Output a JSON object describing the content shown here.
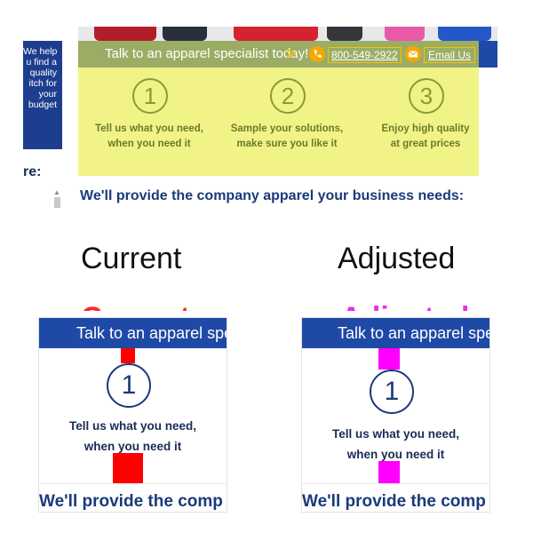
{
  "left_panel": {
    "lines": [
      "We help",
      "u find a",
      "quality",
      "itch for",
      "your",
      "budget"
    ]
  },
  "side_heading": "re:",
  "cta_bar": {
    "text": "Talk to an apparel specialist today!",
    "chevron": ">",
    "phone": "800-549-2922",
    "email": "Email Us",
    "phone_icon": "phone-icon",
    "mail_icon": "mail-icon"
  },
  "steps": [
    {
      "number": "1",
      "line1": "Tell us what you need,",
      "line2": "when you need it"
    },
    {
      "number": "2",
      "line1": "Sample your solutions,",
      "line2": "make sure you like it"
    },
    {
      "number": "3",
      "line1": "Enjoy high quality",
      "line2": "at great prices"
    }
  ],
  "provide_text": "We'll provide the company apparel your business needs:",
  "labels": {
    "current": "Current",
    "adjusted": "Adjusted"
  },
  "panels": {
    "bar_text": "Talk to an apparel speci",
    "number": "1",
    "line1": "Tell us what you need,",
    "line2": "when you need it",
    "bottom_text": "We'll provide the comp"
  },
  "colors": {
    "brand_blue": "#1f49a6",
    "highlight_yellow": "#e8eb3e",
    "current_marker": "#ff0000",
    "adjusted_marker": "#ff00ff"
  }
}
